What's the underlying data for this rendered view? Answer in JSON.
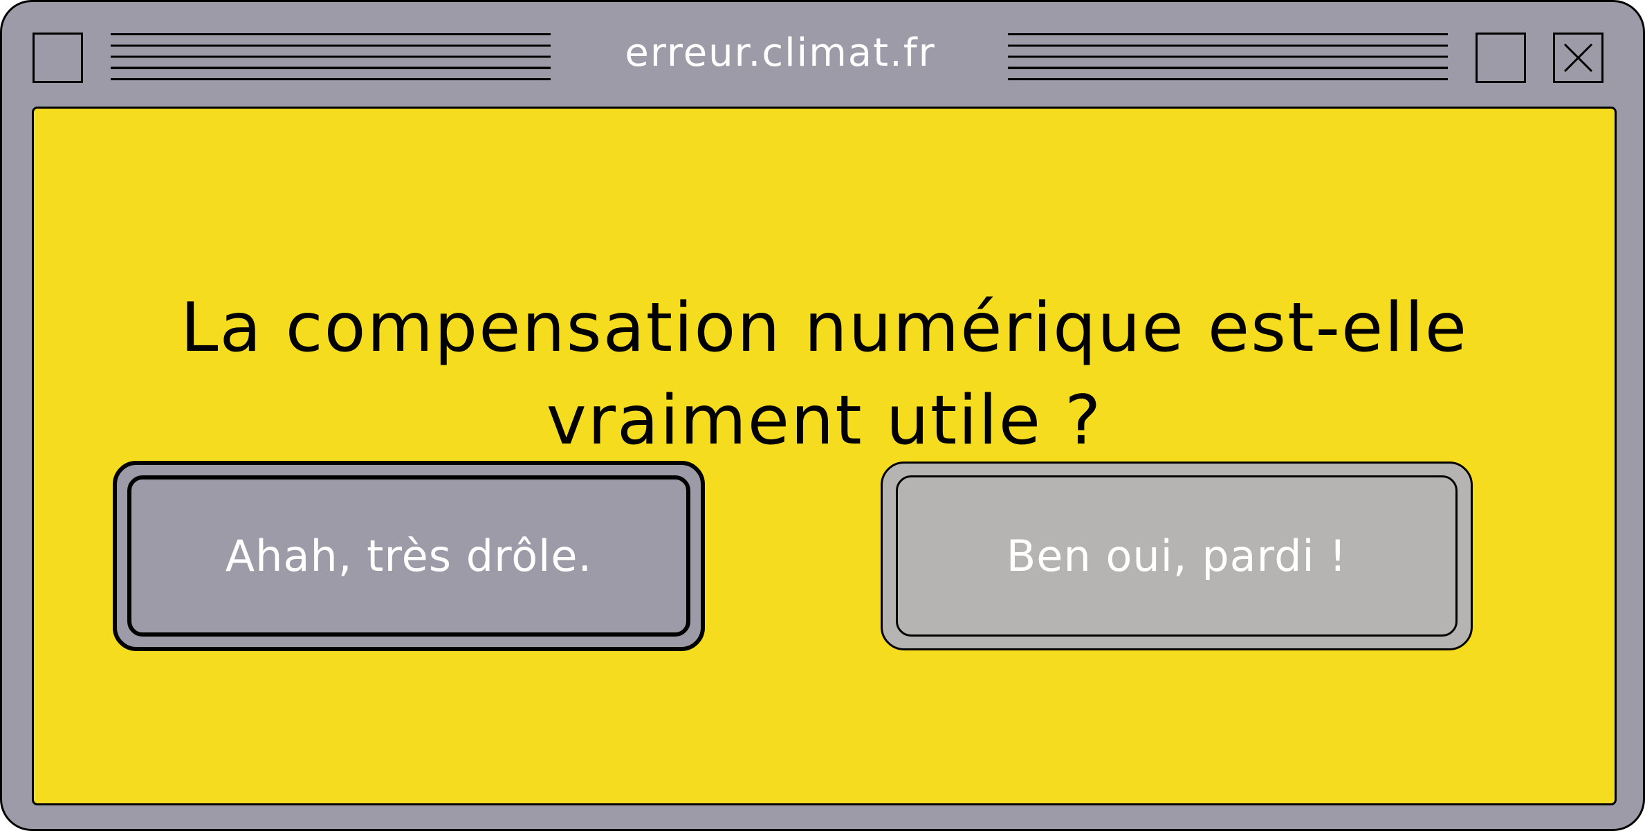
{
  "window": {
    "title": "erreur.climat.fr",
    "controls": [
      "window-menu-box",
      "maximize-box",
      "close-box"
    ]
  },
  "dialog": {
    "question_line1": "La compensation numérique est-elle",
    "question_line2": "vraiment utile ?",
    "buttons": [
      {
        "label": "Ahah, très drôle.",
        "state": "selected"
      },
      {
        "label": "Ben oui, pardi !",
        "state": "default"
      }
    ]
  },
  "colors": {
    "frame": "#9d9ba7",
    "content_bg": "#f6dc1e",
    "button_a_bg": "#9d9ba7",
    "button_b_bg": "#b5b4b3",
    "text_light": "#ffffff",
    "text_dark": "#000000"
  }
}
